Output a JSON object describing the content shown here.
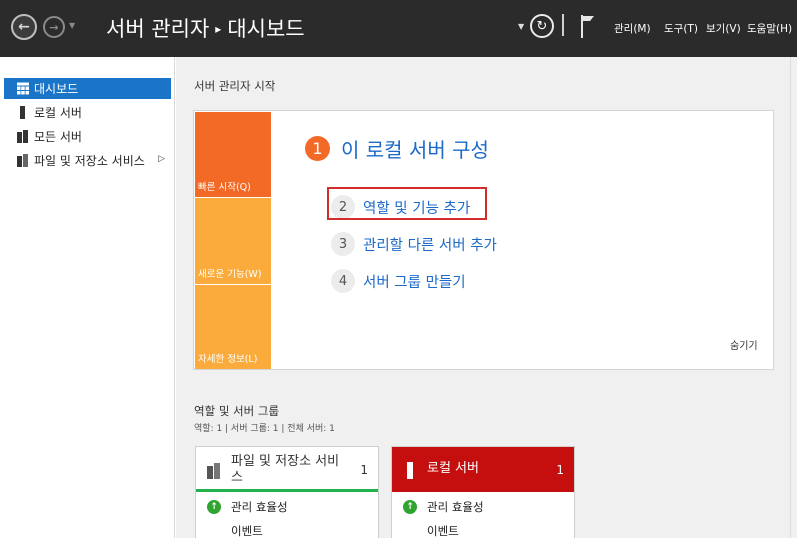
{
  "titlebar": {
    "title_app": "서버 관리자",
    "title_page": "대시보드",
    "menu": [
      "관리(M)",
      "도구(T)",
      "보기(V)",
      "도움말(H)"
    ]
  },
  "sidebar": {
    "items": [
      {
        "label": "대시보드"
      },
      {
        "label": "로컬 서버"
      },
      {
        "label": "모든 서버"
      },
      {
        "label": "파일 및 저장소 서비스"
      }
    ]
  },
  "main": {
    "section_head": "서버 관리자 시작",
    "tiles": [
      "빠른 시작(Q)",
      "새로운 기능(W)",
      "자세한 정보(L)"
    ],
    "step1": {
      "num": "1",
      "text": "이 로컬 서버 구성"
    },
    "steps": [
      {
        "num": "2",
        "text": "역할 및 기능 추가"
      },
      {
        "num": "3",
        "text": "관리할 다른 서버 추가"
      },
      {
        "num": "4",
        "text": "서버 그룹 만들기"
      }
    ],
    "hide": "숨기기",
    "roles_title": "역할 및 서버 그룹",
    "roles_sub": "역할: 1  |  서버 그룹: 1  |  전체 서버: 1",
    "cards": [
      {
        "title": "파일 및 저장소 서비스",
        "count": "1",
        "status": "관리 효율성",
        "event": "이벤트"
      },
      {
        "title": "로컬 서버",
        "count": "1",
        "status": "관리 효율성",
        "event": "이벤트"
      }
    ]
  },
  "colors": {
    "titlebar": "#2b2b2b",
    "accent_blue": "#1a74c8",
    "tile_orange": "#f26a26",
    "tile_yellow": "#fbab3b",
    "local_server_red": "#c50f0f",
    "status_green": "#2fa52f",
    "highlight_red": "#d22c2c"
  },
  "icons": {
    "back": "back-arrow-icon",
    "forward": "forward-arrow-icon",
    "refresh": "refresh-icon",
    "flag": "notification-flag-icon",
    "dashboard": "dashboard-grid-icon",
    "server": "server-icon",
    "servers": "servers-icon",
    "storage": "file-storage-icon",
    "status_ok": "status-up-icon"
  }
}
